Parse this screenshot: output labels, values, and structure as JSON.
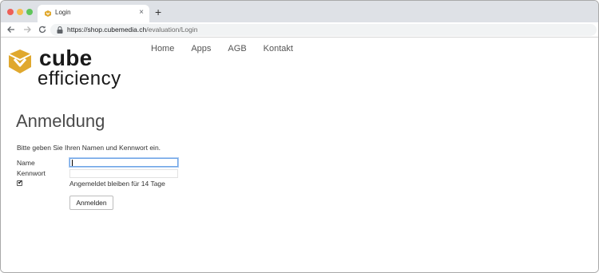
{
  "browser": {
    "tab_title": "Login",
    "new_tab_symbol": "+",
    "tab_close_symbol": "×",
    "url_host": "https://shop.cubemedia.ch",
    "url_path": "/evaluation/Login"
  },
  "logo": {
    "line1": "cube",
    "line2": "efficiency",
    "brand_color": "#e0a82e"
  },
  "nav": {
    "items": [
      "Home",
      "Apps",
      "AGB",
      "Kontakt"
    ]
  },
  "login": {
    "title": "Anmeldung",
    "intro": "Bitte geben Sie Ihren Namen und Kennwort ein.",
    "name_label": "Name",
    "name_value": "",
    "password_label": "Kennwort",
    "password_value": "",
    "remember_checked": true,
    "remember_label": "Angemeldet bleiben für 14 Tage",
    "submit_label": "Anmelden"
  }
}
